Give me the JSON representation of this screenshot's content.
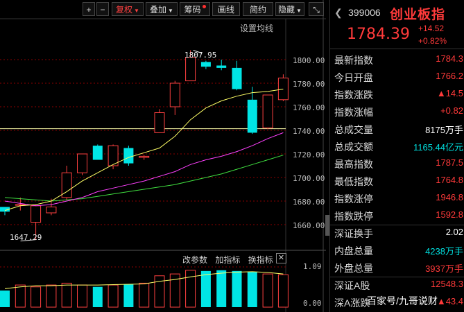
{
  "toolbar": {
    "plus": "+",
    "minus": "−",
    "fuquan": "复权",
    "diejia": "叠加",
    "chouma": "筹码",
    "huaxian": "画线",
    "jianyue": "简约",
    "yincang": "隐藏",
    "collapse": "⤡"
  },
  "ma_setting": "设置均线",
  "y_labels": [
    "1800.00",
    "1780.00",
    "1760.00",
    "1740.00",
    "1720.00",
    "1700.00",
    "1680.00",
    "1660.00"
  ],
  "annotations": {
    "high": "1807.95",
    "low": "1647.29"
  },
  "sub_toolbar": {
    "params": "改参数",
    "add": "加指标",
    "switch": "换指标",
    "close": "✕"
  },
  "sub_y_labels": [
    "1.09",
    "0.00"
  ],
  "quote": {
    "code": "399006",
    "name": "创业板指",
    "last": "1784.39",
    "change": "+14.52",
    "change_pct": "+0.82%",
    "rows": [
      {
        "label": "最新指数",
        "value": "1784.3",
        "color": "red"
      },
      {
        "label": "今日开盘",
        "value": "1766.2",
        "color": "red"
      },
      {
        "label": "指数涨跌",
        "value": "▲14.5",
        "color": "red"
      },
      {
        "label": "指数涨幅",
        "value": "+0.82",
        "color": "red"
      },
      {
        "label": "总成交量",
        "value": "8175万手",
        "color": "white"
      },
      {
        "label": "总成交额",
        "value": "1165.44亿元",
        "color": "cyan"
      },
      {
        "label": "最高指数",
        "value": "1787.5",
        "color": "red"
      },
      {
        "label": "最低指数",
        "value": "1764.8",
        "color": "red"
      },
      {
        "label": "指数涨停",
        "value": "1946.8",
        "color": "red"
      },
      {
        "label": "指数跌停",
        "value": "1592.8",
        "color": "red"
      },
      {
        "label": "深证换手",
        "value": "2.02",
        "color": "white"
      },
      {
        "label": "内盘总量",
        "value": "4238万手",
        "color": "cyan"
      },
      {
        "label": "外盘总量",
        "value": "3937万手",
        "color": "red"
      },
      {
        "label": "深证A股",
        "value": "12548.3",
        "color": "red"
      },
      {
        "label": "深A涨跌",
        "value": "▲43.4",
        "color": "red"
      }
    ]
  },
  "watermark": "百家号/九哥说财",
  "colors": {
    "up": "#ff4040",
    "down": "#00e5e5",
    "ma5": "#ffff66",
    "ma10": "#ff40ff",
    "ma20": "#40e040",
    "grid": "#8b0000"
  },
  "chart_data": {
    "type": "candlestick",
    "ylim": [
      1648,
      1820
    ],
    "candles": [
      {
        "o": 1671,
        "h": 1675,
        "c": 1675,
        "l": 1668,
        "dir": "down"
      },
      {
        "o": 1677,
        "h": 1683,
        "c": 1677,
        "l": 1672,
        "dir": "up"
      },
      {
        "o": 1662,
        "h": 1677,
        "c": 1676,
        "l": 1647.29,
        "dir": "up"
      },
      {
        "o": 1670,
        "h": 1682,
        "c": 1675,
        "l": 1668,
        "dir": "up"
      },
      {
        "o": 1683,
        "h": 1710,
        "c": 1704,
        "l": 1681,
        "dir": "up"
      },
      {
        "o": 1704,
        "h": 1720,
        "c": 1720,
        "l": 1702,
        "dir": "up"
      },
      {
        "o": 1727,
        "h": 1728,
        "c": 1715,
        "l": 1715,
        "dir": "down"
      },
      {
        "o": 1710,
        "h": 1728,
        "c": 1727,
        "l": 1707,
        "dir": "up"
      },
      {
        "o": 1725,
        "h": 1727,
        "c": 1712,
        "l": 1710,
        "dir": "down"
      },
      {
        "o": 1718,
        "h": 1719,
        "c": 1717,
        "l": 1715,
        "dir": "up"
      },
      {
        "o": 1738,
        "h": 1758,
        "c": 1755,
        "l": 1738,
        "dir": "up"
      },
      {
        "o": 1760,
        "h": 1782,
        "c": 1780,
        "l": 1753,
        "dir": "up"
      },
      {
        "o": 1782,
        "h": 1807.95,
        "c": 1802,
        "l": 1782,
        "dir": "up"
      },
      {
        "o": 1798,
        "h": 1799,
        "c": 1794,
        "l": 1792,
        "dir": "down"
      },
      {
        "o": 1795,
        "h": 1800,
        "c": 1793,
        "l": 1791,
        "dir": "down"
      },
      {
        "o": 1793,
        "h": 1799,
        "c": 1775,
        "l": 1774,
        "dir": "down"
      },
      {
        "o": 1766,
        "h": 1777,
        "c": 1738,
        "l": 1737,
        "dir": "down"
      },
      {
        "o": 1742,
        "h": 1770,
        "c": 1770,
        "l": 1741,
        "dir": "up"
      },
      {
        "o": 1766,
        "h": 1787.5,
        "c": 1784.39,
        "l": 1764.8,
        "dir": "up"
      }
    ],
    "ma5": [
      1672,
      1676,
      1677,
      1680,
      1688,
      1697,
      1704,
      1711,
      1717,
      1721,
      1725,
      1735,
      1749,
      1759,
      1765,
      1769,
      1772,
      1773,
      1775
    ],
    "ma10": [
      1680,
      1678,
      1676,
      1677,
      1680,
      1683,
      1688,
      1691,
      1694,
      1697,
      1701,
      1705,
      1711,
      1715,
      1718,
      1722,
      1727,
      1733,
      1738
    ],
    "ma20": [
      1683,
      1682,
      1681,
      1680,
      1681,
      1682,
      1684,
      1686,
      1688,
      1690,
      1692,
      1694,
      1697,
      1700,
      1703,
      1707,
      1711,
      1715,
      1719
    ],
    "reference_line": 1742,
    "volume": [
      0.45,
      0.6,
      0.55,
      0.6,
      0.65,
      0.6,
      0.55,
      0.6,
      0.62,
      0.65,
      0.85,
      0.9,
      1.0,
      0.98,
      1.0,
      0.98,
      0.95,
      0.9,
      0.88
    ],
    "volume_ratio_line": [
      0.5,
      0.55,
      0.58,
      0.58,
      0.6,
      0.6,
      0.6,
      0.61,
      0.62,
      0.63,
      0.7,
      0.75,
      0.82,
      0.88,
      0.92,
      0.95,
      0.96,
      0.94,
      0.9
    ]
  }
}
